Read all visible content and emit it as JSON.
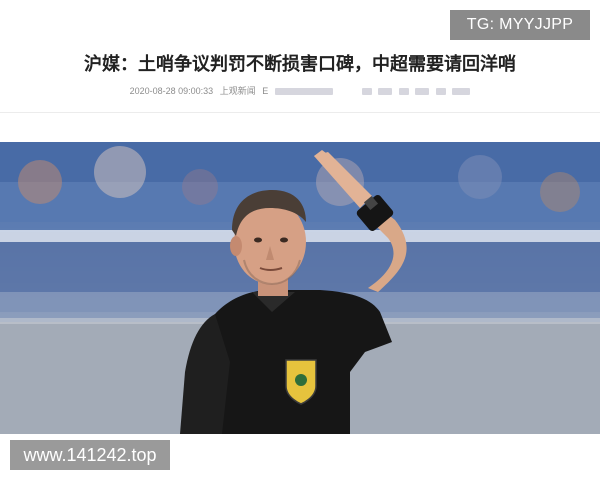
{
  "watermark": {
    "tg": "TG: MYYJJPP",
    "url": "www.141242.top"
  },
  "article": {
    "headline": "沪媒：土哨争议判罚不断损害口碑，中超需要请回洋哨",
    "timestamp": "2020-08-28 09:00:33",
    "source": "上观新闻",
    "author_prefix": "E"
  },
  "image": {
    "subject": "referee-raising-arm",
    "colors": {
      "stadium": "#4a6aa0",
      "jersey": "#1a1a1a",
      "badge": "#e9c23a"
    }
  }
}
